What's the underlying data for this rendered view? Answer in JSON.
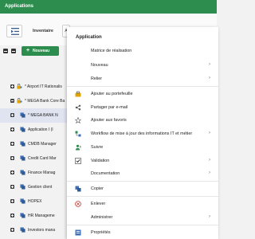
{
  "topbar": {
    "title": "Applications"
  },
  "toolbar": {
    "tab_inventaire": "Inventaire",
    "tab_chip": "A"
  },
  "tree_tools": {
    "new_label": "Nouveau"
  },
  "tree": [
    {
      "label": "* Airport IT Rationalis",
      "icon": "lock-user-icon",
      "level": 1,
      "expanded": false
    },
    {
      "label": "* MEGA Bank Core Ba",
      "icon": "lock-user-icon",
      "level": 1,
      "expanded": true
    },
    {
      "label": "* MEGA BANK N",
      "icon": "application-icon",
      "level": 2,
      "selected": true
    },
    {
      "label": "Application I (I",
      "icon": "application-icon",
      "level": 2
    },
    {
      "label": "CMDB Manager",
      "icon": "application-icon",
      "level": 2
    },
    {
      "label": "Credit Card Mar",
      "icon": "application-icon",
      "level": 2
    },
    {
      "label": "Finance Manag",
      "icon": "application-icon",
      "level": 2
    },
    {
      "label": "Gestion client",
      "icon": "application-icon",
      "level": 2
    },
    {
      "label": "HOPEX",
      "icon": "application-icon",
      "level": 2
    },
    {
      "label": "HR Manageme",
      "icon": "application-icon",
      "level": 2
    },
    {
      "label": "Investors mana",
      "icon": "application-icon",
      "level": 2
    }
  ],
  "menu": {
    "title": "Application",
    "items": [
      {
        "label": "Matrice de réalisation",
        "icon": "",
        "submenu": false
      },
      {
        "label": "Nouveau",
        "icon": "",
        "submenu": true
      },
      {
        "label": "Relier",
        "icon": "",
        "submenu": true
      },
      {
        "label": "Ajouter au portefeuille",
        "icon": "portfolio-icon",
        "submenu": false
      },
      {
        "label": "Partager par e-mail",
        "icon": "share-icon",
        "submenu": false
      },
      {
        "label": "Ajouter aux favoris",
        "icon": "star-icon",
        "submenu": false
      },
      {
        "label": "Workflow de mise à jour des informations IT et métier",
        "icon": "workflow-icon",
        "submenu": true
      },
      {
        "label": "Suivre",
        "icon": "follow-icon",
        "submenu": false
      },
      {
        "label": "Validation",
        "icon": "validation-icon",
        "submenu": true
      },
      {
        "label": "Documentation",
        "icon": "",
        "submenu": true
      },
      {
        "label": "Copier",
        "icon": "copy-icon",
        "submenu": false
      },
      {
        "label": "Enlever",
        "icon": "remove-icon",
        "submenu": false
      },
      {
        "label": "Administrer",
        "icon": "",
        "submenu": true
      },
      {
        "label": "Propriétés",
        "icon": "properties-icon",
        "submenu": false
      }
    ]
  },
  "colors": {
    "brand_green": "#2d8d4f",
    "selected_row": "#dfe4f0"
  }
}
